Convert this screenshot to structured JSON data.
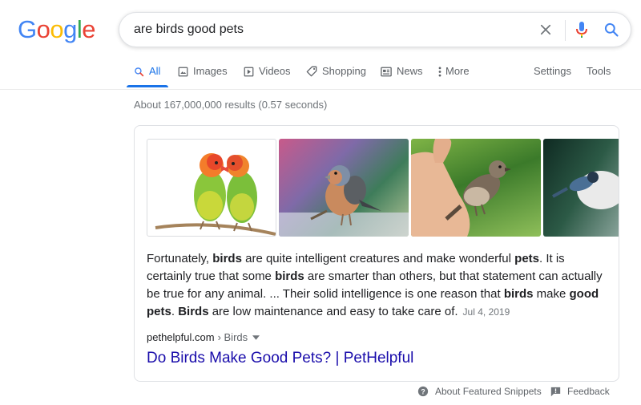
{
  "logo": {
    "text": "Google",
    "letters": [
      "G",
      "o",
      "o",
      "g",
      "l",
      "e"
    ]
  },
  "colors": {
    "blue": "#4285F4",
    "red": "#EA4335",
    "yellow": "#FBBC05",
    "green": "#34A853",
    "link": "#1a0dab",
    "accent": "#1a73e8"
  },
  "search": {
    "query": "are birds good pets",
    "icons": [
      "clear-icon",
      "microphone-icon",
      "search-icon"
    ]
  },
  "tabs": [
    {
      "label": "All",
      "icon": "search-icon",
      "active": true
    },
    {
      "label": "Images",
      "icon": "image-icon"
    },
    {
      "label": "Videos",
      "icon": "video-icon"
    },
    {
      "label": "Shopping",
      "icon": "tag-icon"
    },
    {
      "label": "News",
      "icon": "news-icon"
    },
    {
      "label": "More",
      "icon": "more-dots-icon"
    }
  ],
  "tools": {
    "settings": "Settings",
    "tools": "Tools"
  },
  "result_stats": "About 167,000,000 results (0.57 seconds)",
  "featured_snippet": {
    "images": [
      {
        "subject": "two lovebirds on a branch"
      },
      {
        "subject": "chaffinch perched on a branch"
      },
      {
        "subject": "sparrow perched on a hand"
      },
      {
        "subject": "small bird at a feeder"
      }
    ],
    "segments": [
      {
        "text": "Fortunately, "
      },
      {
        "text": "birds",
        "bold": true
      },
      {
        "text": " are quite intelligent creatures and make wonderful "
      },
      {
        "text": "pets",
        "bold": true
      },
      {
        "text": ". It is certainly true that some "
      },
      {
        "text": "birds",
        "bold": true
      },
      {
        "text": " are smarter than others, but that statement can actually be true for any animal. ... Their solid intelligence is one reason that "
      },
      {
        "text": "birds",
        "bold": true
      },
      {
        "text": " make "
      },
      {
        "text": "good",
        "bold": true
      },
      {
        "text": " "
      },
      {
        "text": "pets",
        "bold": true
      },
      {
        "text": ". "
      },
      {
        "text": "Birds",
        "bold": true
      },
      {
        "text": " are low maintenance and easy to take care of."
      }
    ],
    "date": "Jul 4, 2019",
    "cite_domain": "pethelpful.com",
    "cite_breadcrumb": "› Birds",
    "title": "Do Birds Make Good Pets? | PetHelpful"
  },
  "footer": {
    "about": "About Featured Snippets",
    "feedback": "Feedback"
  }
}
